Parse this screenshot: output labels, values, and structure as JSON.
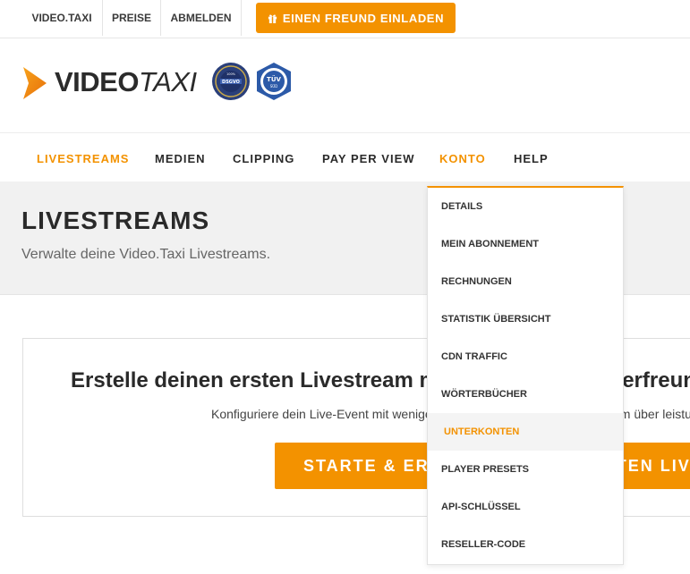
{
  "topbar": {
    "links": [
      "VIDEO.TAXI",
      "PREISE",
      "ABMELDEN"
    ],
    "invite_label": "EINEN FREUND EINLADEN"
  },
  "logo": {
    "bold": "VIDEO",
    "italic": "TAXI"
  },
  "nav": {
    "items": [
      "LIVESTREAMS",
      "MEDIEN",
      "CLIPPING",
      "PAY PER VIEW",
      "KONTO",
      "HELP"
    ]
  },
  "page": {
    "title": "LIVESTREAMS",
    "subtitle": "Verwalte deine Video.Taxi Livestreams."
  },
  "card": {
    "title": "Erstelle deinen ersten Livestream mit unserem benutzerfreundlichen Interface bedienen",
    "subtitle": "Konfiguriere dein Live-Event mit wenigen Klicks und erreiche dein Publikum über leistungsstarke Video-Streams",
    "cta_label": "STARTE & ERZEUGE DEINEN ERSTEN LIVESTREAM"
  },
  "dropdown": {
    "items": [
      "DETAILS",
      "MEIN ABONNEMENT",
      "RECHNUNGEN",
      "STATISTIK ÜBERSICHT",
      "CDN TRAFFIC",
      "WÖRTERBÜCHER",
      "UNTERKONTEN",
      "PLAYER PRESETS",
      "API-SCHLÜSSEL",
      "RESELLER-CODE"
    ],
    "highlighted": "UNTERKONTEN"
  },
  "colors": {
    "accent": "#f39200",
    "text": "#2a2a2a",
    "panel": "#f1f1f1"
  },
  "icons": {
    "invite": "gift-icon",
    "logo": "play-triangle-icon"
  }
}
